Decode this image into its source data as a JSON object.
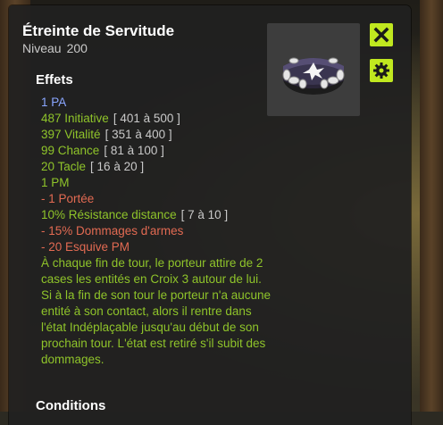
{
  "tooltip": {
    "title": "Étreinte de Servitude",
    "level_label": "Niveau",
    "level_value": "200",
    "effects_title": "Effets",
    "conditions_title": "Conditions",
    "effects": [
      {
        "text": "1 PA",
        "range": "",
        "color": "#8aa6ff"
      },
      {
        "text": "487 Initiative",
        "range": "[ 401 à 500 ]",
        "color": "#8fc42a"
      },
      {
        "text": "397 Vitalité",
        "range": "[ 351 à 400 ]",
        "color": "#8fc42a"
      },
      {
        "text": "99 Chance",
        "range": "[ 81 à 100 ]",
        "color": "#8fc42a"
      },
      {
        "text": "20 Tacle",
        "range": "[ 16 à 20 ]",
        "color": "#8fc42a"
      },
      {
        "text": "1 PM",
        "range": "",
        "color": "#8fc42a"
      },
      {
        "text": "- 1 Portée",
        "range": "",
        "color": "#e26a52"
      },
      {
        "text": "10% Résistance distance",
        "range": "[ 7 à 10 ]",
        "color": "#8fc42a"
      },
      {
        "text": "- 15% Dommages d'armes",
        "range": "",
        "color": "#e26a52"
      },
      {
        "text": "- 20 Esquive PM",
        "range": "",
        "color": "#e26a52"
      }
    ],
    "description": "À chaque fin de tour, le porteur attire de 2 cases les entités en Croix 3 autour de lui. Si à la fin de son tour le porteur n'a aucune entité à son contact, alors il rentre dans l'état Indéplaçable jusqu'au début de son prochain tour. L'état est retiré s'il subit des dommages.",
    "item_icon": "collar-icon",
    "close_icon": "close-icon",
    "settings_icon": "gear-icon",
    "accent_color": "#c0e81f"
  }
}
